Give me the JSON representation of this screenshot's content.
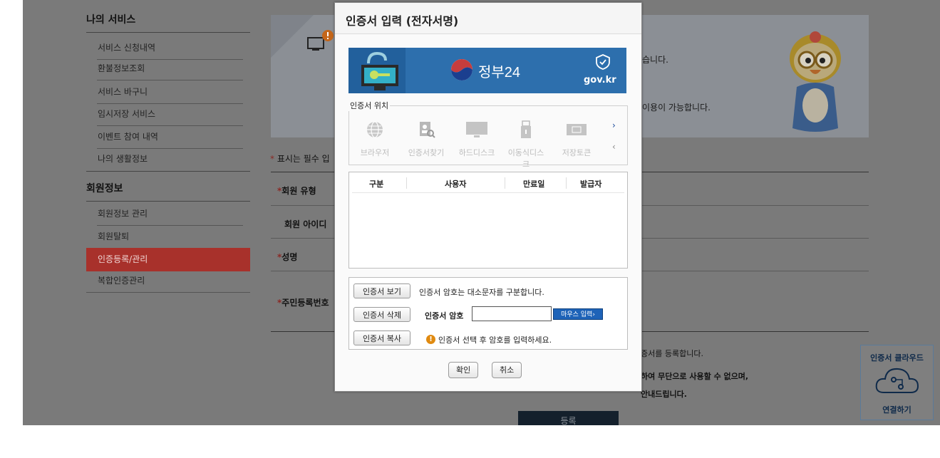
{
  "sidebar": {
    "service_title": "나의 서비스",
    "service_items": [
      {
        "label": "서비스 신청내역"
      },
      {
        "label": "환불정보조회"
      },
      {
        "label": "서비스 바구니"
      },
      {
        "label": "임시저장 서비스"
      },
      {
        "label": "이벤트 참여 내역"
      },
      {
        "label": "나의 생활정보"
      }
    ],
    "member_title": "회원정보",
    "member_items": [
      {
        "label": "회원정보 관리"
      },
      {
        "label": "회원탈퇴"
      },
      {
        "label": "인증등록/관리"
      },
      {
        "label": "복합인증관리"
      }
    ]
  },
  "banner": {
    "line1": "습니다.",
    "line2": "이용이 가능합니다."
  },
  "form": {
    "required_note": "표시는 필수 입",
    "required_mark": "*",
    "fields": [
      {
        "label": "회원 유형"
      },
      {
        "label": "회원 아이디"
      },
      {
        "label": "성명"
      },
      {
        "label": "주민등록번호"
      }
    ],
    "notice1": "증서를 등록합니다.",
    "notice2": "하여 무단으로 사용할 수 없으며,",
    "notice3": "안내드립니다.",
    "submit": "등록"
  },
  "cloud": {
    "title": "인증서 클라우드",
    "action": "연결하기"
  },
  "modal": {
    "title": "인증서 입력 (전자서명)",
    "gov_brand": "정부24",
    "gov_domain": "gov.kr",
    "location_legend": "인증서 위치",
    "locations": [
      {
        "label": "브라우저",
        "icon": "globe-icon"
      },
      {
        "label": "인증서찾기",
        "icon": "cert-search-icon"
      },
      {
        "label": "하드디스크",
        "icon": "monitor-icon"
      },
      {
        "label": "이동식디스크",
        "icon": "usb-icon"
      },
      {
        "label": "저장토큰",
        "icon": "token-icon"
      }
    ],
    "table_headers": [
      "구분",
      "사용자",
      "만료일",
      "발급자"
    ],
    "btn_view": "인증서 보기",
    "btn_delete": "인증서 삭제",
    "btn_copy": "인증서 복사",
    "case_notice": "인증서 암호는 대소문자를 구분합니다.",
    "pw_label": "인증서 암호",
    "pw_value": "",
    "mouse_input": "마우스 입력›",
    "hint": "인증서 선택 후 암호를 입력하세요.",
    "ok": "확인",
    "cancel": "취소"
  },
  "colors": {
    "accent_red": "#a8312b",
    "gov_blue": "#2d6fad",
    "mouse_btn": "#1e63b8"
  }
}
